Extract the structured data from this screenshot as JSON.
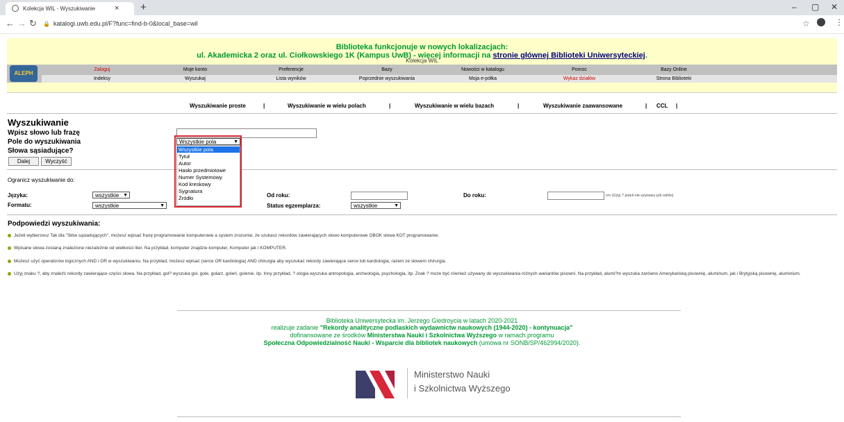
{
  "browser": {
    "tab_title": "Kolekcja WIL - Wyszukiwanie",
    "tab_close": "×",
    "new_tab": "+",
    "url": "katalogi.uwb.edu.pl/F?func=find-b-0&local_base=wil",
    "win_min": "–",
    "win_max": "▢",
    "win_close": "✕"
  },
  "banner": {
    "line1": "Biblioteka funkcjonuje w nowych lokalizacjach:",
    "line2_prefix": "ul. Akademicka 2 oraz ul. Ciołkowskiego 1K (Kampus UwB) - więcej informacji na ",
    "line2_link": "stronie głównej Biblioteki Uniwersyteckiej",
    "line2_suffix": ".",
    "collection": "Kolekcja WIL"
  },
  "logo": "ALEPH",
  "menu": {
    "row1": [
      "Zaloguj",
      "Moje konto",
      "Preferencje",
      "Bazy",
      "Nowości w katalogu",
      "Pomoc",
      "Bazy Online"
    ],
    "row2": [
      "Indeksy",
      "Wyszukaj",
      "Lista wyników",
      "Poprzednie wyszukiwania",
      "Moja e-półka",
      "Wykaz działów",
      "Strona Biblioteki"
    ]
  },
  "search_tabs": [
    "Wyszukiwanie proste",
    "|",
    "Wyszukiwanie w wielu polach",
    "|",
    "Wyszukiwanie w wielu bazach",
    "|",
    "Wyszukiwanie zaawansowane",
    "|",
    "CCL",
    "|"
  ],
  "form": {
    "title": "Wyszukiwanie",
    "phrase_label": "Wpisz słowo lub frazę",
    "field_label": "Pole do wyszukiwania",
    "adjacent_label": "Słowa sąsiadujące?",
    "field_selected": "Wszystkie pola",
    "field_options": [
      "Wszystkie pola",
      "Tytuł",
      "Autor",
      "Hasło przedmiotowe",
      "Numer Systemowy",
      "Kod kreskowy",
      "Sygnatura",
      "Źródło"
    ],
    "btn_next": "Dalej",
    "btn_clear": "Wyczyść"
  },
  "limits": {
    "title": "Ogranicz wyszukiwanie do:",
    "language_label": "Języka:",
    "language_value": "wszystkie",
    "format_label": "Formatu:",
    "format_value": "wszystkie",
    "from_year_label": "Od roku:",
    "to_year_label": "Do roku:",
    "year_hint": "rrrr (Użyj ? jeżeli nie używasz pól od/do)",
    "status_label": "Status egzemplarza:",
    "status_value": "wszystkie"
  },
  "hints": {
    "title": "Podpowiedzi wyszukiwania:",
    "items": [
      "Jeżeli wybierzesz Tak dla \"Słów sąsiadujących\", możesz wpisać frazę programowanie komputerowe a system zrozumie, że szukasz rekordów zawierających słowo komputerowe OBOK słowa KOT programowanie.",
      "Wpisane słowa zostaną znalezione niezależnie od wielkości liter. Na przykład, komputer znajdzie komputer, Komputer jak i KOMPUTER.",
      "Możesz użyć operatorów logicznych AND i OR w wyszukiwaniu. Na przykład, możesz wpisać (serce OR kardiologia) AND chirurgia aby wyszukać rekordy zawierające serce lub kardiologia, razem ze słowem chirurgia.",
      "Użyj znaku ?, aby znaleźć rekordy zawierające części słowa. Na przykład, gol? wyszuka gol, gole, golarz, goleń, golenie, itp. Inny przykład, ? ologia wyszuka antropologia, archeologia, psychologia, itp. Znak ? może być również używany do wyszukiwania różnych wariantów pisowni. Na przykład, alumi?m wyszuka zarówno Amerykańską pisownię, aluminum, jak i Brytyjską pisownię, aluminium."
    ]
  },
  "footer": {
    "line1": "Biblioteka Uniwersytecka im. Jerzego Giedroycia w latach 2020-2021",
    "line2_prefix": "realizuje zadanie ",
    "line2_bold": "\"Rekordy analityczne podlaskich wydawnictw naukowych (1944-2020) - kontynuacja\"",
    "line3_prefix": "dofinansowane ze środków ",
    "line3_bold": "Ministerstwa Nauki i Szkolnictwa Wyższego",
    "line3_suffix": " w ramach programu",
    "line4_bold": "Społeczna Odpowiedzialność Nauki - Wsparcie dla bibliotek naukowych",
    "line4_suffix": " (umowa nr SONB/SP/462994/2020).",
    "ministry_line1": "Ministerstwo Nauki",
    "ministry_line2": "i Szkolnictwa Wyższego"
  },
  "colors": {
    "banner_bg": "#fefec8",
    "notice_green": "#009933",
    "menu_gray": "#c0c0c0",
    "highlight_red": "#d8262e",
    "dropdown_selected": "#1e73e8"
  }
}
